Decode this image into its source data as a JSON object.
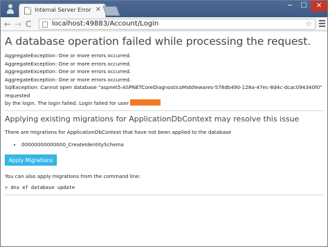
{
  "browser": {
    "tab_title": "Internal Server Error",
    "tab_close": "×",
    "url": "localhost:49883/Account/Login",
    "win_min": "─",
    "win_max": "☐",
    "win_close": "✕",
    "nav_back": "←",
    "nav_fwd": "→",
    "nav_reload": "C",
    "star": "☆"
  },
  "page": {
    "title": "A database operation failed while processing the request.",
    "errors": [
      "AggregateException: One or more errors occurred.",
      "AggregateException: One or more errors occurred.",
      "AggregateException: One or more errors occurred.",
      "AggregateException: One or more errors occurred."
    ],
    "sql_error_line1": "SqlException: Cannot open database \"aspnet5-ASPNETCoreDiagnosticsMiddlewares-578db490-128a-47ec-8d4c-dcac094340f0\" requested",
    "sql_error_line2": "by the login. The login failed. Login failed for user",
    "migrations_heading": "Applying existing migrations for ApplicationDbContext may resolve this issue",
    "migrations_text": "There are migrations for ApplicationDbContext that have not been applied to the database",
    "migrations": [
      "00000000000000_CreateIdentitySchema"
    ],
    "apply_button": "Apply Migrations",
    "cli_text": "You can also apply migrations from the command line:",
    "command": "> dnx ef database update"
  },
  "colors": {
    "redaction": "#f07a24",
    "button": "#34b8ea"
  }
}
